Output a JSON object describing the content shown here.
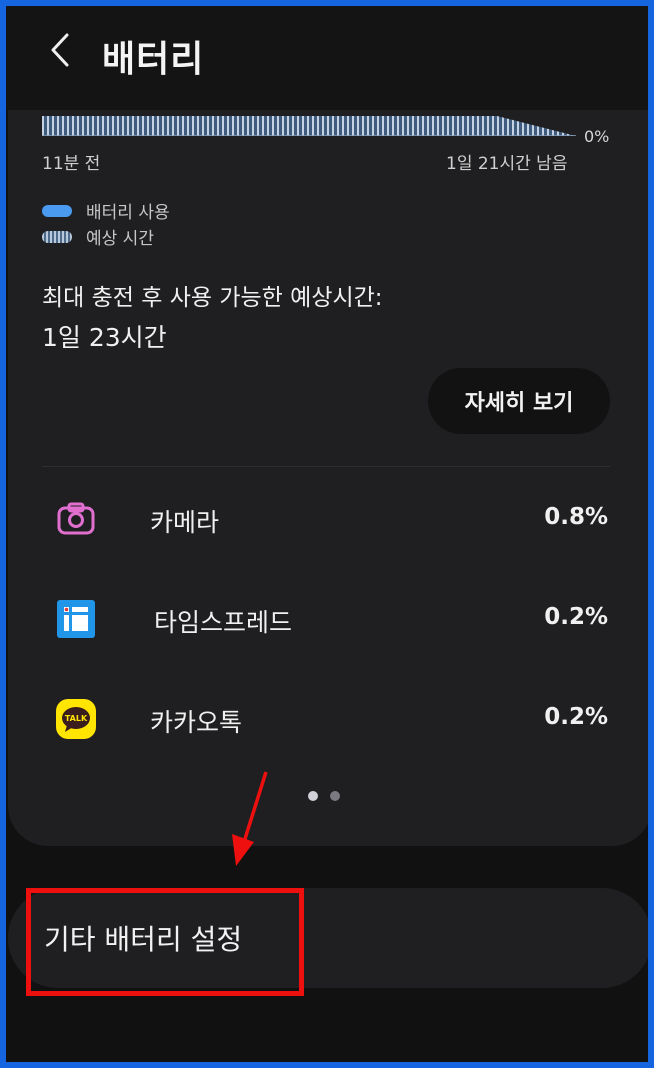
{
  "header": {
    "title": "배터리",
    "back_icon": "chevron-left-icon"
  },
  "graph": {
    "axis_end_label": "0%",
    "time_start": "11분 전",
    "time_end": "1일 21시간 남음",
    "colors": {
      "usage": "#4a9af2",
      "estimate": "#4e6a8a"
    }
  },
  "legend": {
    "usage": "배터리 사용",
    "estimate": "예상 시간"
  },
  "estimate": {
    "label": "최대 충전 후 사용 가능한 예상시간:",
    "value": "1일 23시간"
  },
  "detail_button": "자세히 보기",
  "apps": [
    {
      "name": "카메라",
      "percent": "0.8%",
      "icon": "camera-icon"
    },
    {
      "name": "타임스프레드",
      "percent": "0.2%",
      "icon": "timespread-icon"
    },
    {
      "name": "카카오톡",
      "percent": "0.2%",
      "icon": "kakaotalk-icon"
    }
  ],
  "kakao_icon_text": "TALK",
  "pager": {
    "pages": 2,
    "current": 1
  },
  "other_settings": "기타 배터리 설정",
  "annotation": {
    "highlight_color": "#ee0f0f",
    "frame_color": "#1565e0"
  }
}
